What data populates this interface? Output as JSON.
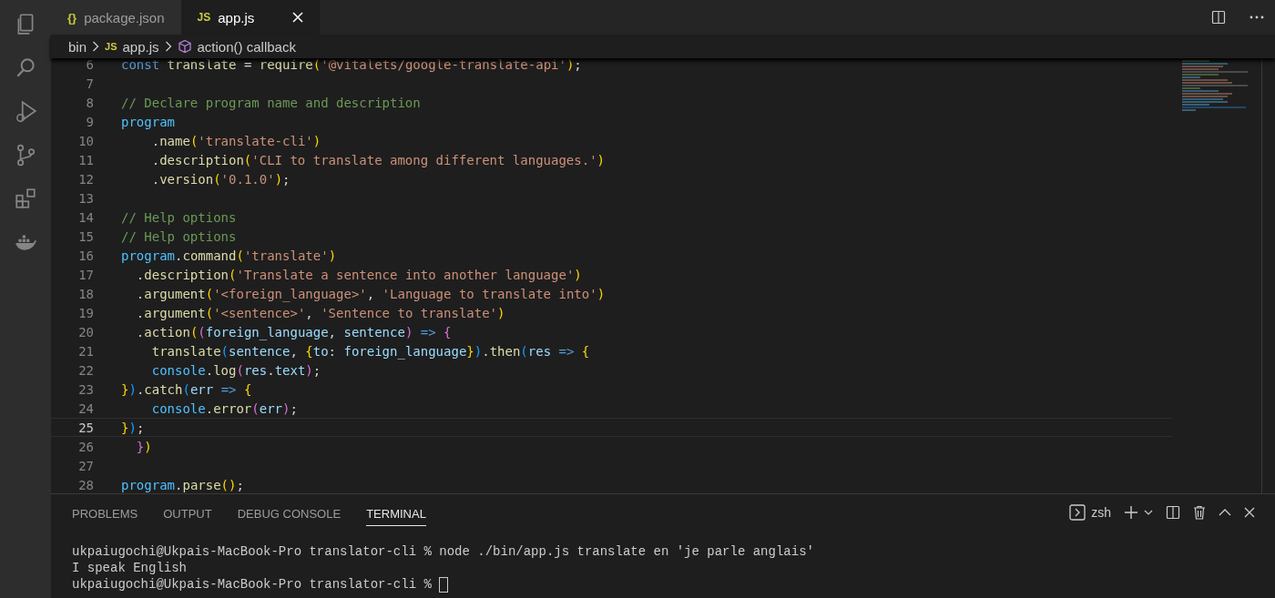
{
  "activity_bar": {
    "items": [
      {
        "kind": "files",
        "selected": false
      },
      {
        "kind": "search",
        "selected": false
      },
      {
        "kind": "debug",
        "selected": false
      },
      {
        "kind": "git",
        "selected": false
      },
      {
        "kind": "extensions",
        "selected": false
      },
      {
        "kind": "docker",
        "selected": false
      }
    ]
  },
  "tabs": [
    {
      "icon": "{}",
      "label": "package.json",
      "selected": false
    },
    {
      "icon": "JS",
      "label": "app.js",
      "selected": true
    }
  ],
  "breadcrumbs": [
    {
      "label": "bin",
      "kind": "folder"
    },
    {
      "label": "app.js",
      "kind": "js",
      "icon": "JS"
    },
    {
      "label": "action() callback",
      "kind": "symbol"
    }
  ],
  "editor": {
    "lines": [
      {
        "n": "6",
        "current": false,
        "toks": [
          {
            "kind": "kw",
            "text": "const"
          },
          {
            "kind": "fn",
            "text": " translate"
          },
          {
            "kind": "p",
            "text": " = "
          },
          {
            "kind": "fn",
            "text": "require"
          },
          {
            "kind": "b1",
            "text": "("
          },
          {
            "kind": "str",
            "text": "'@vitalets/google-translate-api'"
          },
          {
            "kind": "b1",
            "text": ")"
          },
          {
            "kind": "p",
            "text": ";"
          }
        ]
      },
      {
        "n": "7",
        "current": false
      },
      {
        "n": "8",
        "current": false,
        "toks": [
          {
            "kind": "com",
            "text": "// Declare program name and description"
          }
        ]
      },
      {
        "n": "9",
        "current": false,
        "toks": [
          {
            "kind": "var",
            "text": "program"
          }
        ]
      },
      {
        "n": "10",
        "current": false,
        "toks": [
          {
            "kind": "p",
            "text": "    ."
          },
          {
            "kind": "fn",
            "text": "name"
          },
          {
            "kind": "b1",
            "text": "("
          },
          {
            "kind": "str",
            "text": "'translate-cli'"
          },
          {
            "kind": "b1",
            "text": ")"
          }
        ]
      },
      {
        "n": "11",
        "current": false,
        "toks": [
          {
            "kind": "fn",
            "text": "    .description"
          },
          {
            "kind": "b1",
            "text": "("
          },
          {
            "kind": "str",
            "text": "'CLI to translate among different languages.'"
          },
          {
            "kind": "b1",
            "text": ")"
          }
        ]
      },
      {
        "n": "12",
        "current": false,
        "toks": [
          {
            "kind": "p",
            "text": "    ."
          },
          {
            "kind": "fn",
            "text": "version"
          },
          {
            "kind": "b1",
            "text": "("
          },
          {
            "kind": "str",
            "text": "'0.1.0'"
          },
          {
            "kind": "b1",
            "text": ")"
          },
          {
            "kind": "p",
            "text": ";"
          }
        ]
      },
      {
        "n": "13",
        "current": false
      },
      {
        "n": "14",
        "current": false,
        "toks": [
          {
            "kind": "com",
            "text": "// Help options"
          }
        ]
      },
      {
        "n": "15",
        "current": false,
        "toks": [
          {
            "kind": "com",
            "text": "// Help options"
          }
        ]
      },
      {
        "n": "16",
        "current": false,
        "toks": [
          {
            "kind": "var",
            "text": "program"
          },
          {
            "kind": "p",
            "text": "."
          },
          {
            "kind": "fn",
            "text": "command"
          },
          {
            "kind": "b1",
            "text": "("
          },
          {
            "kind": "str",
            "text": "'translate'"
          },
          {
            "kind": "b1",
            "text": ")"
          }
        ]
      },
      {
        "n": "17",
        "current": false,
        "toks": [
          {
            "kind": "fn",
            "text": "  .description"
          },
          {
            "kind": "b1",
            "text": "("
          },
          {
            "kind": "str",
            "text": "'Translate a sentence into another language'"
          },
          {
            "kind": "b1",
            "text": ")"
          }
        ]
      },
      {
        "n": "18",
        "current": false,
        "toks": [
          {
            "kind": "p",
            "text": "  ."
          },
          {
            "kind": "fn",
            "text": "argument"
          },
          {
            "kind": "b1",
            "text": "("
          },
          {
            "kind": "str",
            "text": "'<foreign_language>'"
          },
          {
            "kind": "p",
            "text": ", "
          },
          {
            "kind": "str",
            "text": "'Language to translate into'"
          },
          {
            "kind": "b1",
            "text": ")"
          }
        ]
      },
      {
        "n": "19",
        "current": false,
        "toks": [
          {
            "kind": "p",
            "text": "  ."
          },
          {
            "kind": "fn",
            "text": "argument"
          },
          {
            "kind": "b1",
            "text": "("
          },
          {
            "kind": "str",
            "text": "'<sentence>'"
          },
          {
            "kind": "p",
            "text": ", "
          },
          {
            "kind": "str",
            "text": "'Sentence to translate'"
          },
          {
            "kind": "b1",
            "text": ")"
          }
        ]
      },
      {
        "n": "20",
        "current": false,
        "toks": [
          {
            "kind": "p",
            "text": "  ."
          },
          {
            "kind": "fn",
            "text": "action"
          },
          {
            "kind": "b1",
            "text": "("
          },
          {
            "kind": "b2",
            "text": "("
          },
          {
            "kind": "prop",
            "text": "foreign_language"
          },
          {
            "kind": "p",
            "text": ", "
          },
          {
            "kind": "prop",
            "text": "sentence"
          },
          {
            "kind": "b2",
            "text": ")"
          },
          {
            "kind": "op",
            "text": " => "
          },
          {
            "kind": "b2",
            "text": "{"
          }
        ]
      },
      {
        "n": "21",
        "current": false,
        "toks": [
          {
            "kind": "fn",
            "text": "    translate"
          },
          {
            "kind": "b3",
            "text": "("
          },
          {
            "kind": "prop",
            "text": "sentence"
          },
          {
            "kind": "p",
            "text": ", "
          },
          {
            "kind": "b1",
            "text": "{"
          },
          {
            "kind": "prop",
            "text": "to"
          },
          {
            "kind": "p",
            "text": ": "
          },
          {
            "kind": "prop",
            "text": "foreign_language"
          },
          {
            "kind": "b1",
            "text": "}"
          },
          {
            "kind": "b3",
            "text": ")"
          },
          {
            "kind": "p",
            "text": "."
          },
          {
            "kind": "fn",
            "text": "then"
          },
          {
            "kind": "b3",
            "text": "("
          },
          {
            "kind": "prop",
            "text": "res"
          },
          {
            "kind": "op",
            "text": " => "
          },
          {
            "kind": "b1",
            "text": "{"
          }
        ]
      },
      {
        "n": "22",
        "current": false,
        "toks": [
          {
            "kind": "var",
            "text": "    console"
          },
          {
            "kind": "p",
            "text": "."
          },
          {
            "kind": "fn",
            "text": "log"
          },
          {
            "kind": "b2",
            "text": "("
          },
          {
            "kind": "prop",
            "text": "res"
          },
          {
            "kind": "p",
            "text": "."
          },
          {
            "kind": "prop",
            "text": "text"
          },
          {
            "kind": "b2",
            "text": ")"
          },
          {
            "kind": "p",
            "text": ";"
          }
        ]
      },
      {
        "n": "23",
        "current": false,
        "toks": [
          {
            "kind": "b1",
            "text": "}"
          },
          {
            "kind": "b3",
            "text": ")"
          },
          {
            "kind": "p",
            "text": "."
          },
          {
            "kind": "fn",
            "text": "catch"
          },
          {
            "kind": "b3",
            "text": "("
          },
          {
            "kind": "prop",
            "text": "err"
          },
          {
            "kind": "op",
            "text": " => "
          },
          {
            "kind": "b1",
            "text": "{"
          }
        ]
      },
      {
        "n": "24",
        "current": false,
        "toks": [
          {
            "kind": "var",
            "text": "    console"
          },
          {
            "kind": "p",
            "text": "."
          },
          {
            "kind": "fn",
            "text": "error"
          },
          {
            "kind": "b2",
            "text": "("
          },
          {
            "kind": "prop",
            "text": "err"
          },
          {
            "kind": "b2",
            "text": ")"
          },
          {
            "kind": "p",
            "text": ";"
          }
        ]
      },
      {
        "n": "25",
        "current": true,
        "toks": [
          {
            "kind": "b1",
            "text": "}"
          },
          {
            "kind": "b3",
            "text": ")"
          },
          {
            "kind": "p",
            "text": ";"
          }
        ]
      },
      {
        "n": "26",
        "current": false,
        "toks": [
          {
            "kind": "b2",
            "text": "  }"
          },
          {
            "kind": "b1",
            "text": ")"
          }
        ]
      },
      {
        "n": "27",
        "current": false
      },
      {
        "n": "28",
        "current": false,
        "toks": [
          {
            "kind": "var",
            "text": "program"
          },
          {
            "kind": "p",
            "text": "."
          },
          {
            "kind": "fn",
            "text": "parse"
          },
          {
            "kind": "b1",
            "text": "("
          },
          {
            "kind": "b1",
            "text": ")"
          },
          {
            "kind": "p",
            "text": ";"
          }
        ]
      }
    ]
  },
  "panel": {
    "tabs": [
      {
        "label": "PROBLEMS",
        "selected": false
      },
      {
        "label": "OUTPUT",
        "selected": false
      },
      {
        "label": "DEBUG CONSOLE",
        "selected": false
      },
      {
        "label": "TERMINAL",
        "selected": true
      }
    ],
    "shell": "zsh",
    "terminal_lines": [
      {
        "text": "ukpaiugochi@Ukpais-MacBook-Pro translator-cli % node ./bin/app.js translate en 'je parle anglais'",
        "cursor": false
      },
      {
        "text": "I speak English",
        "cursor": false
      },
      {
        "text": "ukpaiugochi@Ukpais-MacBook-Pro translator-cli % ",
        "cursor": true
      }
    ]
  }
}
